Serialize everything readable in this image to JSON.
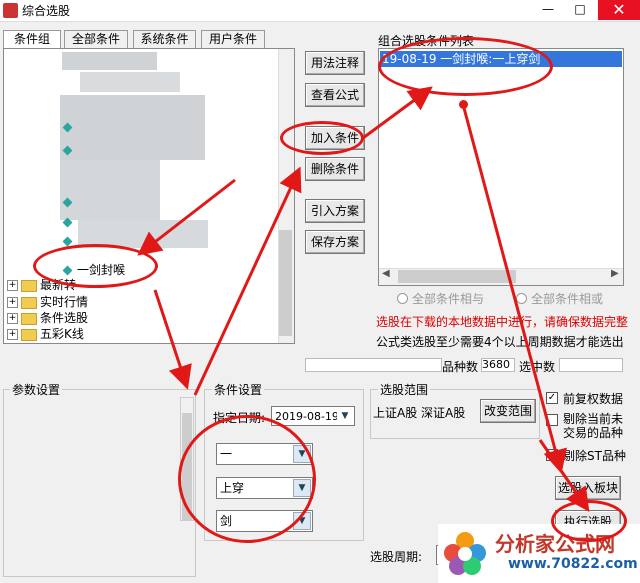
{
  "window": {
    "title": "综合选股",
    "min": "—",
    "max": "□",
    "close": "✕"
  },
  "tabs": [
    "条件组",
    "全部条件",
    "系统条件",
    "用户条件"
  ],
  "tree": {
    "highlighted_item": "一剑封喉",
    "folders": [
      "最新转",
      "实时行情",
      "条件选股",
      "五彩K线"
    ]
  },
  "middle_buttons": {
    "usage_notes": "用法注释",
    "view_formula": "查看公式",
    "add_condition": "加入条件",
    "delete_condition": "删除条件",
    "import_scheme": "引入方案",
    "save_scheme": "保存方案"
  },
  "condition_list": {
    "label": "组合选股条件列表",
    "items": [
      "19-08-19 一剑封喉:一上穿剑"
    ]
  },
  "logic": {
    "all_and": "全部条件相与",
    "all_or": "全部条件相或"
  },
  "notices": {
    "line1": "选股在下载的本地数据中进行，请确保数据完整",
    "line2": "公式类选股至少需要4个以上周期数据才能选出"
  },
  "stats": {
    "count_label": "品种数",
    "count_value": "3680",
    "selected_label": "选中数",
    "selected_value": ""
  },
  "params": {
    "label": "参数设置"
  },
  "condition_settings": {
    "label": "条件设置",
    "date_label": "指定日期:",
    "date_value": "2019-08-19",
    "selects": [
      "一",
      "上穿",
      "剑"
    ]
  },
  "range": {
    "label": "选股范围",
    "value": "上证A股 深证A股",
    "change_button": "改变范围"
  },
  "options": {
    "pre_restore": "前复权数据",
    "exclude_suspended": "剔除当前未交易的品种",
    "exclude_st": "剔除ST品种"
  },
  "actions": {
    "to_block": "选股入板块",
    "execute": "执行选股"
  },
  "period": {
    "label": "选股周期:"
  },
  "watermark": {
    "text": "分析家公式网",
    "url": "www.70822.com"
  }
}
